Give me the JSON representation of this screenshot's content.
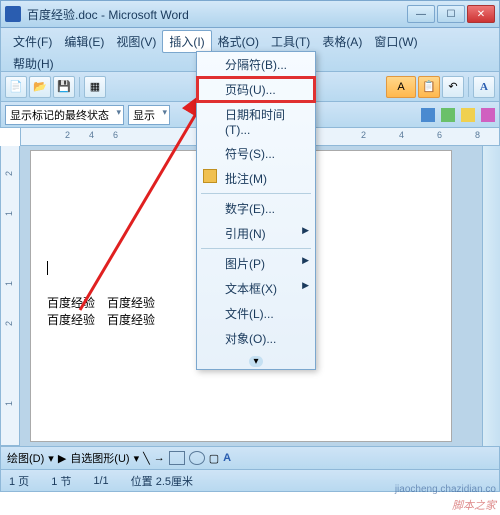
{
  "title": "百度经验.doc - Microsoft Word",
  "menu": {
    "file": "文件(F)",
    "edit": "编辑(E)",
    "view": "视图(V)",
    "insert": "插入(I)",
    "format": "格式(O)",
    "tools": "工具(T)",
    "table": "表格(A)",
    "window": "窗口(W)",
    "help": "帮助(H)"
  },
  "toolbar2": {
    "combo1": "显示标记的最终状态",
    "combo2": "显示"
  },
  "dropdown": {
    "break": "分隔符(B)...",
    "page_numbers": "页码(U)...",
    "datetime": "日期和时间(T)...",
    "symbol": "符号(S)...",
    "comment": "批注(M)",
    "number": "数字(E)...",
    "reference": "引用(N)",
    "picture": "图片(P)",
    "textbox": "文本框(X)",
    "file": "文件(L)...",
    "object": "对象(O)..."
  },
  "doc_text": {
    "t1": "百度经验",
    "t2": "百度经验",
    "t3": "百度经验",
    "t4": "百度经验"
  },
  "bottom": {
    "draw": "绘图(D)",
    "autoshape": "自选图形(U)"
  },
  "status": {
    "page": "1 页",
    "sec": "1 节",
    "pages": "1/1",
    "pos": "位置 2.5厘米"
  },
  "ruler_h": [
    "2",
    "4",
    "6",
    "2",
    "4",
    "6",
    "8"
  ],
  "ruler_v": [
    "2",
    "1",
    "1",
    "2",
    "1"
  ],
  "watermark": "脚本之家",
  "watermark2": "jiaocheng.chazidian.co"
}
